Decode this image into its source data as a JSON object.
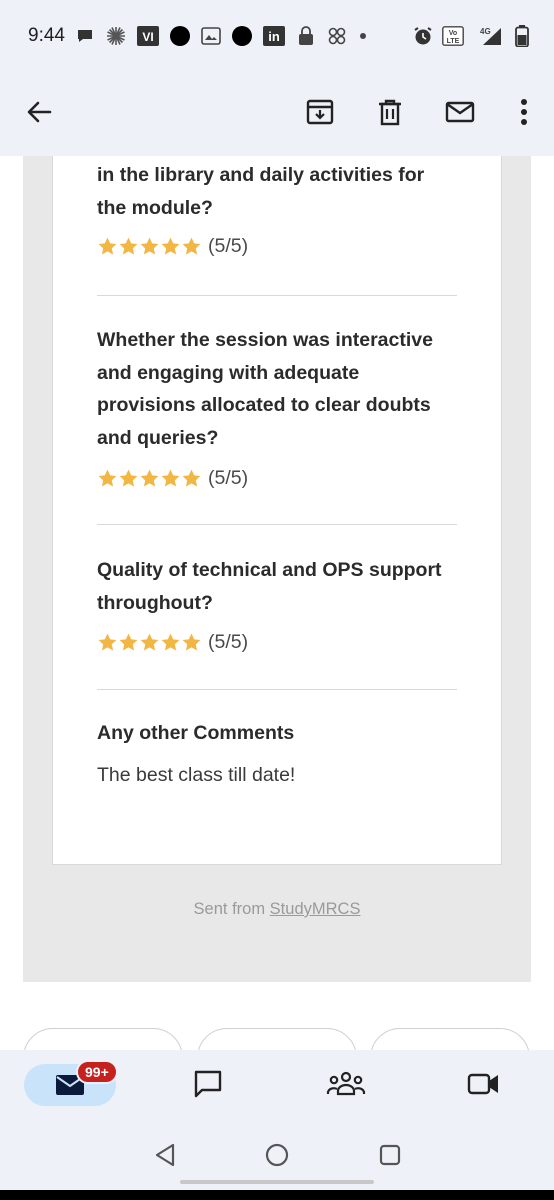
{
  "status_bar": {
    "time": "9:44",
    "left_icons": [
      "chat-bubble-icon",
      "asterisk-icon",
      "vi-app-icon",
      "circle-app-icon",
      "image-app-icon",
      "circle-app-icon",
      "linkedin-icon",
      "lock-bag-icon",
      "pinwheel-icon",
      "dot-icon"
    ],
    "right_icons": [
      "alarm-icon",
      "volte-icon",
      "4g-signal-icon",
      "battery-icon"
    ],
    "vi_label": "VI",
    "linkedin_label": "in",
    "volte_label": "Vo LTE",
    "network_label": "4G"
  },
  "app_bar": {
    "back_icon": "arrow-left-icon",
    "actions": [
      "archive-icon",
      "delete-icon",
      "mark-unread-icon",
      "more-vert-icon"
    ]
  },
  "email": {
    "questions": [
      {
        "text": "in the library and daily activities for the module?",
        "rating": 5,
        "score_label": "(5/5)"
      },
      {
        "text": "Whether the session was interactive and engaging with adequate provisions allocated to clear doubts and queries?",
        "rating": 5,
        "score_label": "(5/5)"
      },
      {
        "text": "Quality of technical and OPS support throughout?",
        "rating": 5,
        "score_label": "(5/5)"
      }
    ],
    "comments_title": "Any other Comments",
    "comments_text": "The best class till date!",
    "sent_from_prefix": "Sent from ",
    "sent_from_link": "StudyMRCS",
    "star_color": "#f2b643"
  },
  "bottom_nav": {
    "items": [
      "mail-icon",
      "chat-icon",
      "spaces-icon",
      "meet-icon"
    ],
    "badge": "99+",
    "active_color": "#c9e3fb"
  },
  "system_nav": {
    "items": [
      "back-triangle-icon",
      "home-circle-icon",
      "recents-square-icon"
    ]
  }
}
